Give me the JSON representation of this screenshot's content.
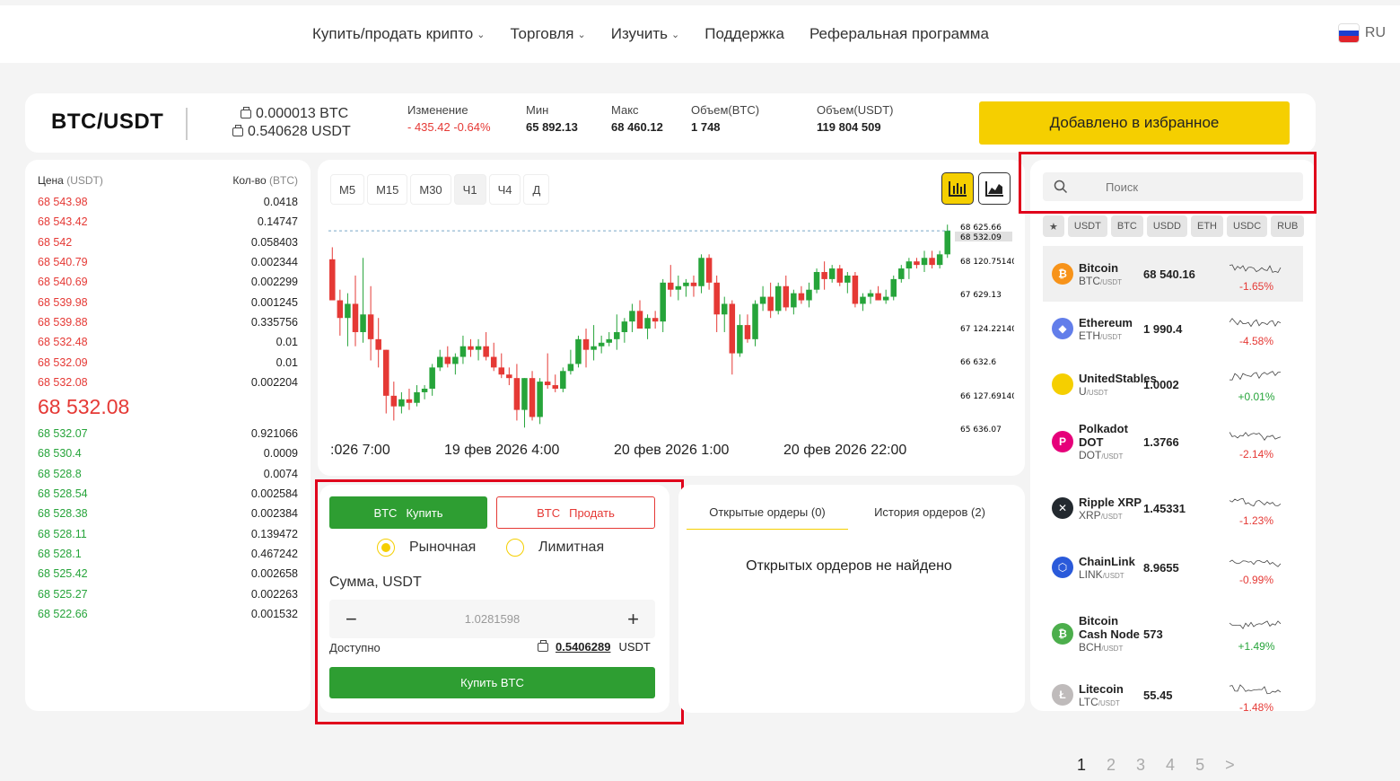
{
  "nav": {
    "items": [
      {
        "label": "Купить/продать крипто",
        "dropdown": true
      },
      {
        "label": "Торговля",
        "dropdown": true
      },
      {
        "label": "Изучить",
        "dropdown": true
      },
      {
        "label": "Поддержка",
        "dropdown": false
      },
      {
        "label": "Реферальная программа",
        "dropdown": false
      }
    ],
    "lang": "RU"
  },
  "header": {
    "pair": "BTC/USDT",
    "balance_btc": "0.000013 BTC",
    "balance_usdt": "0.540628 USDT",
    "stats": [
      {
        "label": "Изменение",
        "value": "- 435.42 -0.64%",
        "color": "#e53935"
      },
      {
        "label": "Мин",
        "value": "65 892.13"
      },
      {
        "label": "Макс",
        "value": "68 460.12"
      },
      {
        "label": "Объем(BTC)",
        "value": "1 748"
      },
      {
        "label": "Объем(USDT)",
        "value": "119 804 509"
      }
    ],
    "fav_button": "Добавлено  в избранное"
  },
  "orderbook": {
    "price_label": "Цена",
    "price_unit": "(USDT)",
    "qty_label": "Кол-во",
    "qty_unit": "(BTC)",
    "asks": [
      [
        "68 543.98",
        "0.0418"
      ],
      [
        "68 543.42",
        "0.14747"
      ],
      [
        "68 542",
        "0.058403"
      ],
      [
        "68 540.79",
        "0.002344"
      ],
      [
        "68 540.69",
        "0.002299"
      ],
      [
        "68 539.98",
        "0.001245"
      ],
      [
        "68 539.88",
        "0.335756"
      ],
      [
        "68 532.48",
        "0.01"
      ],
      [
        "68 532.09",
        "0.01"
      ],
      [
        "68 532.08",
        "0.002204"
      ]
    ],
    "last_price": "68 532.08",
    "bids": [
      [
        "68 532.07",
        "0.921066"
      ],
      [
        "68 530.4",
        "0.0009"
      ],
      [
        "68 528.8",
        "0.0074"
      ],
      [
        "68 528.54",
        "0.002584"
      ],
      [
        "68 528.38",
        "0.002384"
      ],
      [
        "68 528.11",
        "0.139472"
      ],
      [
        "68 528.1",
        "0.467242"
      ],
      [
        "68 525.42",
        "0.002658"
      ],
      [
        "68 525.27",
        "0.002263"
      ],
      [
        "68 522.66",
        "0.001532"
      ]
    ]
  },
  "chart": {
    "timeframes": [
      "M5",
      "M15",
      "M30",
      "Ч1",
      "Ч4",
      "Д"
    ],
    "active_timeframe": "Ч1",
    "price_labels": [
      "68 625.66",
      "68 532.09",
      "68 120.75140",
      "67 629.13",
      "67 124.22140",
      "66 632.6",
      "66 127.69140",
      "65 636.07"
    ],
    "date_labels": [
      ":026 7:00",
      "19 фев 2026 4:00",
      "20 фев 2026 1:00",
      "20 фев 2026 22:00"
    ]
  },
  "chart_data": {
    "type": "candlestick",
    "ylim": [
      65500,
      68750
    ],
    "last_price": 68532.09,
    "candles": [
      [
        68130,
        68300,
        67600,
        67550
      ],
      [
        67550,
        67700,
        67050,
        67300
      ],
      [
        67300,
        67650,
        66900,
        67500
      ],
      [
        67500,
        67900,
        66900,
        67100
      ],
      [
        67100,
        68150,
        66950,
        67350
      ],
      [
        67350,
        67750,
        66700,
        67000
      ],
      [
        67000,
        67300,
        66600,
        66850
      ],
      [
        66850,
        66850,
        65950,
        66200
      ],
      [
        66200,
        66400,
        65850,
        66050
      ],
      [
        66050,
        66250,
        65950,
        66150
      ],
      [
        66150,
        66300,
        66000,
        66100
      ],
      [
        66100,
        66350,
        66050,
        66250
      ],
      [
        66250,
        66350,
        66150,
        66300
      ],
      [
        66300,
        66650,
        66200,
        66600
      ],
      [
        66600,
        66850,
        66550,
        66750
      ],
      [
        66750,
        66900,
        66600,
        66650
      ],
      [
        66650,
        66800,
        66500,
        66750
      ],
      [
        66750,
        67050,
        66650,
        66900
      ],
      [
        66900,
        67000,
        66750,
        66850
      ],
      [
        66850,
        67000,
        66700,
        66900
      ],
      [
        66900,
        67100,
        66700,
        66750
      ],
      [
        66750,
        66950,
        66550,
        66600
      ],
      [
        66600,
        66800,
        66450,
        66500
      ],
      [
        66500,
        66600,
        66350,
        66450
      ],
      [
        66450,
        66650,
        65850,
        66000
      ],
      [
        66000,
        66450,
        65750,
        66450
      ],
      [
        66450,
        66550,
        65850,
        65900
      ],
      [
        65900,
        66450,
        65800,
        66400
      ],
      [
        66400,
        66800,
        66300,
        66350
      ],
      [
        66350,
        66500,
        66250,
        66300
      ],
      [
        66300,
        66600,
        66250,
        66550
      ],
      [
        66550,
        66850,
        66500,
        66650
      ],
      [
        66650,
        67050,
        66600,
        67000
      ],
      [
        67000,
        67150,
        66600,
        66850
      ],
      [
        66850,
        67200,
        66700,
        66900
      ],
      [
        66900,
        67050,
        66800,
        66950
      ],
      [
        66950,
        67100,
        66900,
        67000
      ],
      [
        67000,
        67350,
        66850,
        67100
      ],
      [
        67100,
        67300,
        66950,
        67250
      ],
      [
        67250,
        67500,
        67100,
        67400
      ],
      [
        67400,
        67550,
        67200,
        67150
      ],
      [
        67150,
        67350,
        67000,
        67300
      ],
      [
        67300,
        67400,
        67150,
        67250
      ],
      [
        67250,
        67850,
        67100,
        67800
      ],
      [
        67800,
        68050,
        67600,
        67700
      ],
      [
        67700,
        67900,
        67550,
        67750
      ],
      [
        67750,
        67850,
        67600,
        67800
      ],
      [
        67800,
        67900,
        67600,
        67750
      ],
      [
        67750,
        68200,
        67650,
        68150
      ],
      [
        68150,
        68200,
        67700,
        67800
      ],
      [
        67800,
        67900,
        67100,
        67350
      ],
      [
        67350,
        67600,
        67100,
        67500
      ],
      [
        67500,
        67550,
        66500,
        66800
      ],
      [
        66800,
        67350,
        66750,
        67200
      ],
      [
        67200,
        67350,
        66950,
        67000
      ],
      [
        67000,
        67550,
        66900,
        67500
      ],
      [
        67500,
        67750,
        67400,
        67600
      ],
      [
        67600,
        67800,
        67300,
        67400
      ],
      [
        67400,
        67800,
        67350,
        67750
      ],
      [
        67750,
        67900,
        67400,
        67450
      ],
      [
        67450,
        67700,
        67350,
        67650
      ],
      [
        67650,
        67750,
        67500,
        67550
      ],
      [
        67550,
        67800,
        67450,
        67700
      ],
      [
        67700,
        68000,
        67650,
        67950
      ],
      [
        67950,
        68100,
        67700,
        67850
      ],
      [
        67850,
        68050,
        67800,
        68000
      ],
      [
        68000,
        68050,
        67750,
        67800
      ],
      [
        67800,
        67950,
        67650,
        67900
      ],
      [
        67900,
        67950,
        67450,
        67500
      ],
      [
        67500,
        67650,
        67400,
        67600
      ],
      [
        67600,
        67700,
        67500,
        67650
      ],
      [
        67650,
        67750,
        67550,
        67550
      ],
      [
        67550,
        67700,
        67500,
        67600
      ],
      [
        67600,
        67900,
        67550,
        67850
      ],
      [
        67850,
        68050,
        67800,
        68000
      ],
      [
        68000,
        68150,
        67850,
        68100
      ],
      [
        68100,
        68150,
        68000,
        68050
      ],
      [
        68050,
        68250,
        67950,
        68150
      ],
      [
        68150,
        68250,
        68000,
        68050
      ],
      [
        68050,
        68250,
        68000,
        68200
      ],
      [
        68200,
        68620,
        68150,
        68532
      ]
    ]
  },
  "trade": {
    "buy_tab": {
      "asset": "BTC",
      "label": "Купить"
    },
    "sell_tab": {
      "asset": "BTC",
      "label": "Продать"
    },
    "order_types": [
      "Рыночная",
      "Лимитная"
    ],
    "selected_type": "Рыночная",
    "amount_label": "Сумма, USDT",
    "amount_value": "1.0281598",
    "available_label": "Доступно",
    "available_value": "0.5406289",
    "available_unit": "USDT",
    "submit": "Купить BTC"
  },
  "orders": {
    "tabs": [
      "Открытые ордеры (0)",
      "История ордеров (2)"
    ],
    "active_tab": 0,
    "empty_text": "Открытых ордеров не найдено"
  },
  "market": {
    "search_placeholder": "Поиск",
    "filters": [
      "★",
      "USDT",
      "BTC",
      "USDD",
      "ETH",
      "USDC",
      "RUB"
    ],
    "coins": [
      {
        "name": "Bitcoin",
        "ticker": "BTC",
        "quote": "/USDT",
        "price": "68 540.16",
        "change": "-1.65%",
        "dir": "down",
        "color": "#f7931a",
        "glyph": "₿"
      },
      {
        "name": "Ethereum",
        "ticker": "ETH",
        "quote": "/USDT",
        "price": "1 990.4",
        "change": "-4.58%",
        "dir": "down",
        "color": "#627eea",
        "glyph": "◆"
      },
      {
        "name": "UnitedStables",
        "ticker": "U",
        "quote": "/USDT",
        "price": "1.0002",
        "change": "+0.01%",
        "dir": "up",
        "color": "#f5cf00",
        "glyph": ""
      },
      {
        "name": "Polkadot DOT",
        "ticker": "DOT",
        "quote": "/USDT",
        "price": "1.3766",
        "change": "-2.14%",
        "dir": "down",
        "color": "#e6007a",
        "glyph": "P"
      },
      {
        "name": "Ripple XRP",
        "ticker": "XRP",
        "quote": "/USDT",
        "price": "1.45331",
        "change": "-1.23%",
        "dir": "down",
        "color": "#23292f",
        "glyph": "✕"
      },
      {
        "name": "ChainLink",
        "ticker": "LINK",
        "quote": "/USDT",
        "price": "8.9655",
        "change": "-0.99%",
        "dir": "down",
        "color": "#2a5ada",
        "glyph": "⬡"
      },
      {
        "name": "Bitcoin Cash Node",
        "ticker": "BCH",
        "quote": "/USDT",
        "price": "573",
        "change": "+1.49%",
        "dir": "up",
        "color": "#4cae4c",
        "glyph": "₿"
      },
      {
        "name": "Litecoin",
        "ticker": "LTC",
        "quote": "/USDT",
        "price": "55.45",
        "change": "-1.48%",
        "dir": "down",
        "color": "#bfbbbb",
        "glyph": "Ł"
      }
    ]
  },
  "pagination": {
    "pages": [
      "1",
      "2",
      "3",
      "4",
      "5",
      ">"
    ],
    "active": "1"
  }
}
